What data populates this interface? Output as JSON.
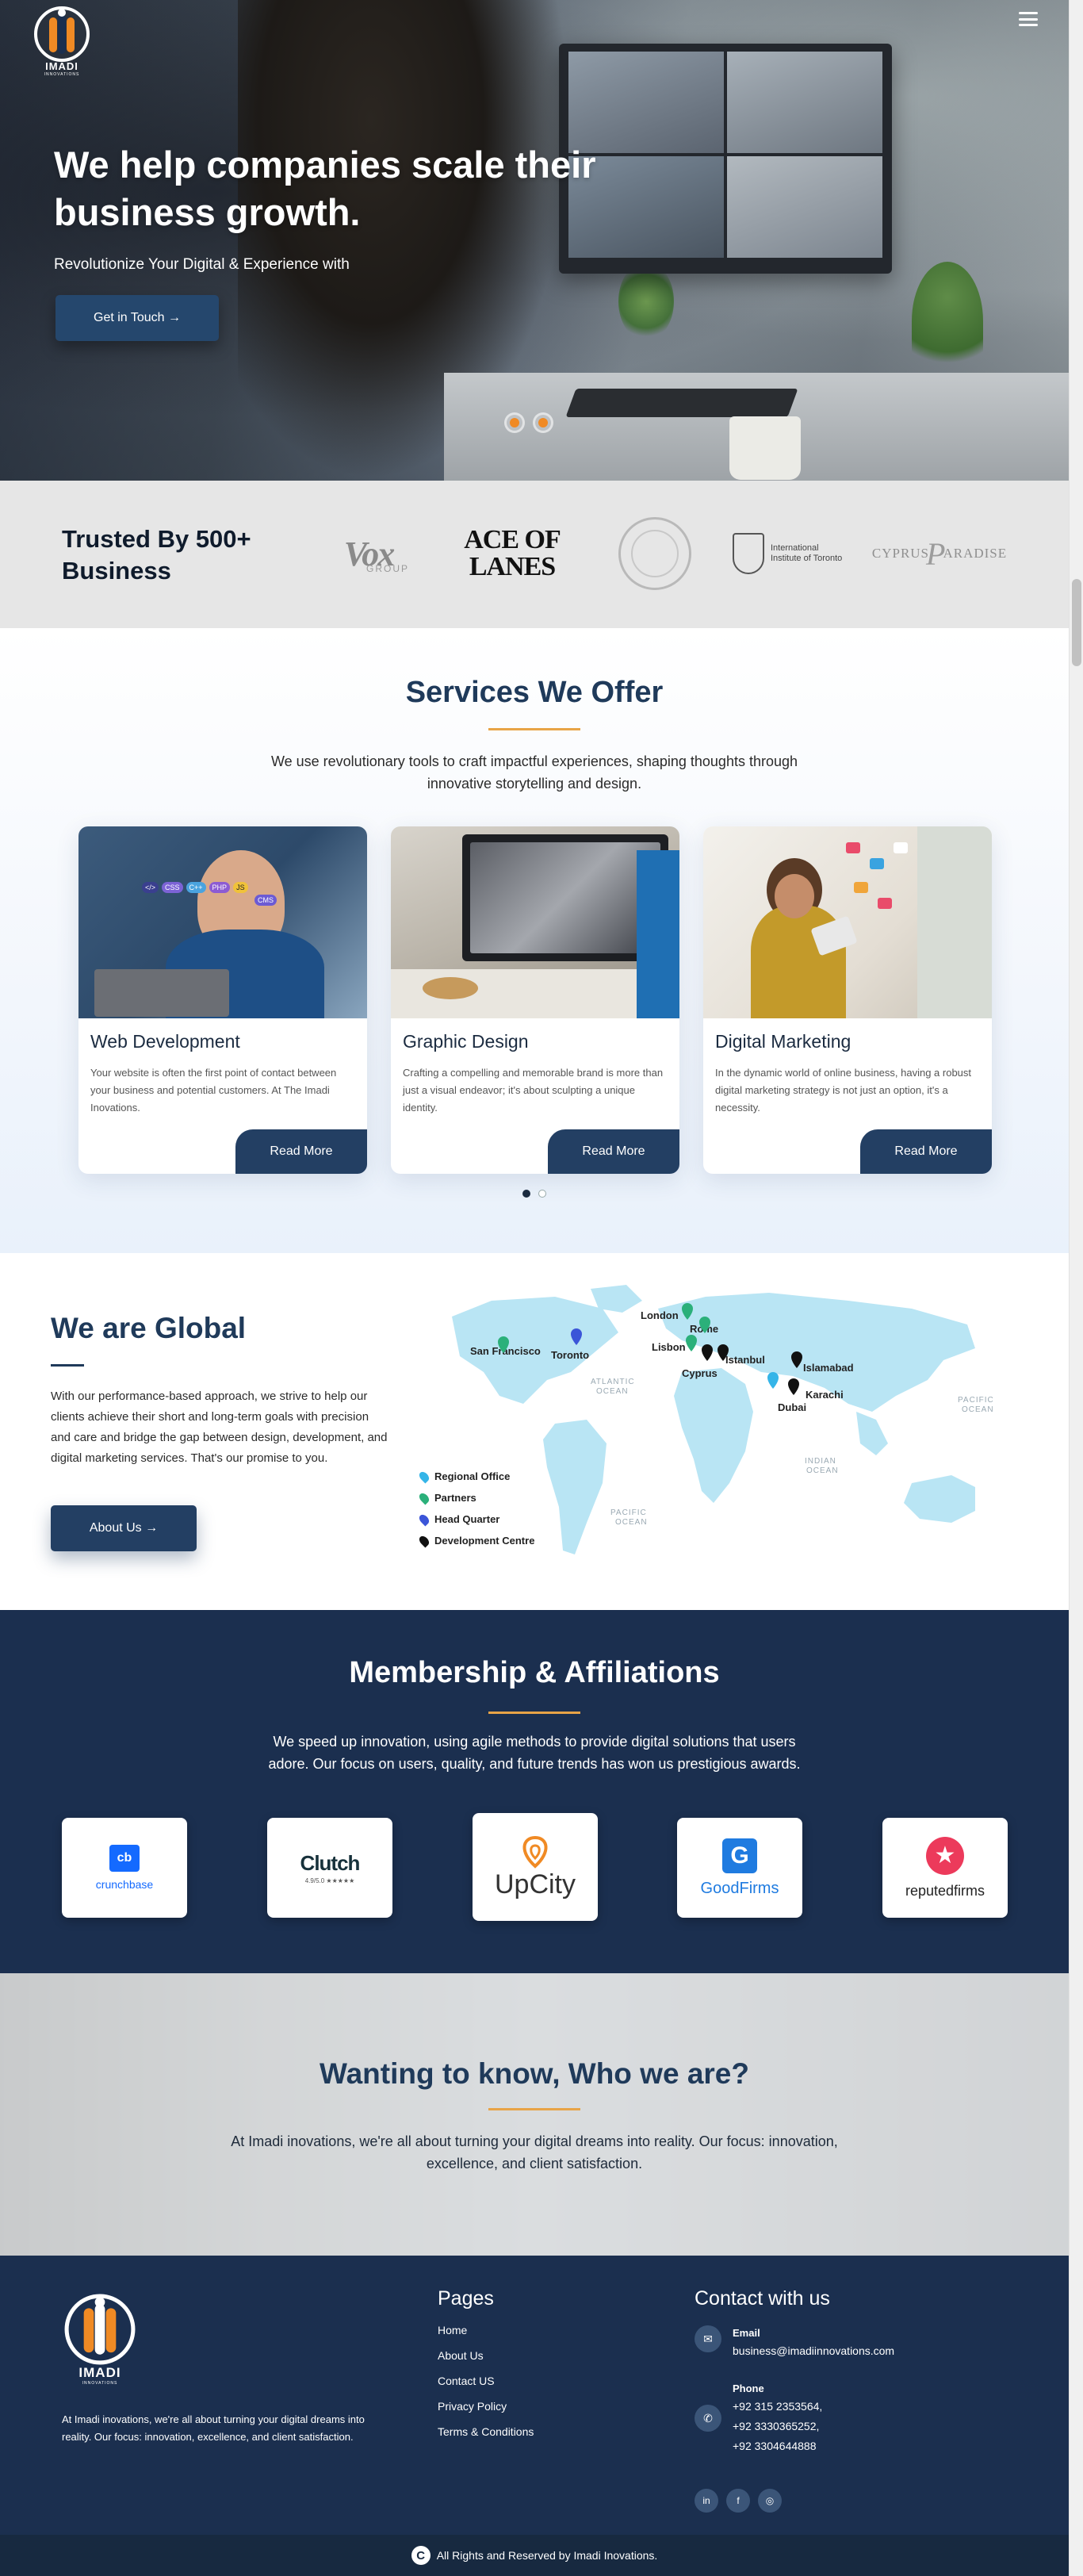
{
  "brand": {
    "name": "IMADI",
    "tagline": "INNOVATIONS",
    "accent": "#f08a24",
    "navy": "#1b2f4f"
  },
  "hero": {
    "title": "We help companies scale their business growth.",
    "subtitle": "Revolutionize Your Digital & Experience with",
    "cta": "Get in Touch →",
    "slides": 2,
    "menu_icon": "hamburger-icon"
  },
  "trusted": {
    "title": "Trusted By 500+ Business",
    "logos": [
      {
        "name": "Vox",
        "sub": "GROUP"
      },
      {
        "name": "ACE OF",
        "line2": "LANES"
      },
      {
        "name": "university-seal"
      },
      {
        "name": "International",
        "line2": "Institute of Toronto"
      },
      {
        "name": "CYPRUS",
        "mid": "P",
        "line2": "ARADISE"
      }
    ]
  },
  "services": {
    "title": "Services We Offer",
    "description": "We use revolutionary tools to craft impactful experiences, shaping thoughts through innovative storytelling and design.",
    "cards": [
      {
        "title": "Web Development",
        "text": "Your website is often the first point of contact between your business and potential customers. At The Imadi Inovations.",
        "button": "Read More"
      },
      {
        "title": "Graphic Design",
        "text": "Crafting a compelling and memorable brand is more than just a visual endeavor; it's about sculpting a unique identity.",
        "button": "Read More"
      },
      {
        "title": "Digital Marketing",
        "text": "In the dynamic world of online business, having a robust digital marketing strategy is not just an option, it's a necessity.",
        "button": "Read More"
      }
    ],
    "web_tags": [
      "CMS",
      "CSS",
      "C++",
      "PHP",
      "</>",
      "JS"
    ]
  },
  "global": {
    "title": "We are Global",
    "text": "With our performance-based approach, we strive to help our clients achieve their short and long-term goals with precision and care and bridge the gap between design, development, and digital marketing services. That's our promise to you.",
    "button": "About Us →",
    "legend": [
      "Regional Office",
      "Partners",
      "Head Quarter",
      "Development Centre"
    ],
    "cities": [
      "San Francisco",
      "Toronto",
      "London",
      "Rome",
      "Lisbon",
      "Cyprus",
      "Istanbul",
      "Islamabad",
      "Dubai",
      "Karachi"
    ],
    "oceans": [
      "ATLANTIC OCEAN",
      "PACIFIC OCEAN",
      "INDIAN OCEAN",
      "PACIFIC OCEAN"
    ]
  },
  "membership": {
    "title": "Membership & Affiliations",
    "description": "We speed up innovation, using agile methods to provide digital solutions that users adore. Our focus on users, quality, and future trends has won us prestigious awards.",
    "items": [
      {
        "logo": "cb",
        "name": "crunchbase"
      },
      {
        "logo": "Clutch",
        "name": "4.9/5.0 ★★★★★"
      },
      {
        "logo": "UpCity"
      },
      {
        "logo": "G",
        "name": "GoodFirms"
      },
      {
        "logo": "★",
        "name": "reputedfirms"
      }
    ]
  },
  "who": {
    "title": "Wanting to know, Who we are?",
    "text": "At Imadi inovations, we're all about turning your digital dreams into reality. Our focus: innovation, excellence, and client satisfaction."
  },
  "footer": {
    "about": "At Imadi inovations, we're all about turning your digital dreams into reality. Our focus: innovation, excellence, and client satisfaction.",
    "pages_title": "Pages",
    "pages": [
      "Home",
      "About Us",
      "Contact US",
      "Privacy Policy",
      "Terms & Conditions"
    ],
    "contact_title": "Contact with us",
    "email_label": "Email",
    "email": "business@imadiinnovations.com",
    "phone_label": "Phone",
    "phones": [
      "+92 315 2353564,",
      "+92 3330365252,",
      "+92 3304644888"
    ],
    "socials": [
      "in",
      "f",
      "◎"
    ],
    "copyright": "All Rights and Reserved by Imadi Inovations."
  }
}
